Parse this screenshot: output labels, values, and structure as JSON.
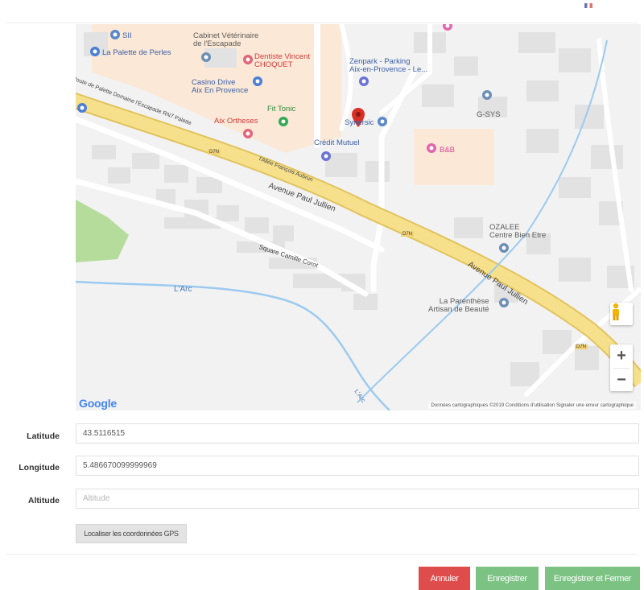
{
  "map": {
    "pois": [
      {
        "label": "SII",
        "color": "blue"
      },
      {
        "label": "La Palette de Perles",
        "color": "blue"
      },
      {
        "label": "Cabinet Vétérinaire\nde l'Escapade",
        "color": "gray"
      },
      {
        "label": "Dentiste Vincent\nCHOQUET",
        "color": "red"
      },
      {
        "label": "Casino Drive\nAix En Provence",
        "color": "blue"
      },
      {
        "label": "Zenpark - Parking\nAix-en-Provence - Le...",
        "color": "blue"
      },
      {
        "label": "Fit Tonic",
        "color": "green"
      },
      {
        "label": "Aix Ortheses",
        "color": "red"
      },
      {
        "label": "Synersic",
        "color": "blue"
      },
      {
        "label": "Crédit Mutuel",
        "color": "blue"
      },
      {
        "label": "G-SYS",
        "color": "gray"
      },
      {
        "label": "B&B",
        "color": "pink"
      },
      {
        "label": "OZALEE\nCentre Bien Etre",
        "color": "gray"
      },
      {
        "label": "La Parenthèse\nArtisan de Beauté",
        "color": "gray"
      }
    ],
    "roads": {
      "main": "Avenue Paul Jullien",
      "main2": "Avenue Paul Jullien",
      "d7n_a": "D7N",
      "d7n_b": "D7N",
      "d7n_c": "D7N",
      "side": "Route de Palette  Domaine l'Escapade RN7 Palette",
      "allee": "l'Allée François Aubrun",
      "square": "Square Camille Corot",
      "river": "L'Arc",
      "river2": "L'Arc"
    },
    "logo": "Google",
    "attribution": "Données cartographiques ©2019   Conditions d'utilisation   Signaler une erreur cartographique",
    "zoom_in": "+",
    "zoom_out": "−",
    "colors": {
      "road_main": "#f6e08c",
      "road_main_border": "#e2c35e",
      "park": "#b6dc9c",
      "water": "#9ccaf0",
      "building": "#e2e2e2",
      "marker": "#d93025"
    }
  },
  "form": {
    "latitude": {
      "label": "Latitude",
      "value": "43.5116515"
    },
    "longitude": {
      "label": "Longitude",
      "value": "5.486670099999969"
    },
    "altitude": {
      "label": "Altitude",
      "value": "",
      "placeholder": "Altitude"
    },
    "gps_button": "Localiser les coordonnées GPS"
  },
  "actions": {
    "cancel": "Annuler",
    "save": "Enregistrer",
    "save_close": "Enregistrer et Fermer",
    "colors": {
      "cancel": "#de4c4c",
      "save": "#7cc383"
    }
  }
}
